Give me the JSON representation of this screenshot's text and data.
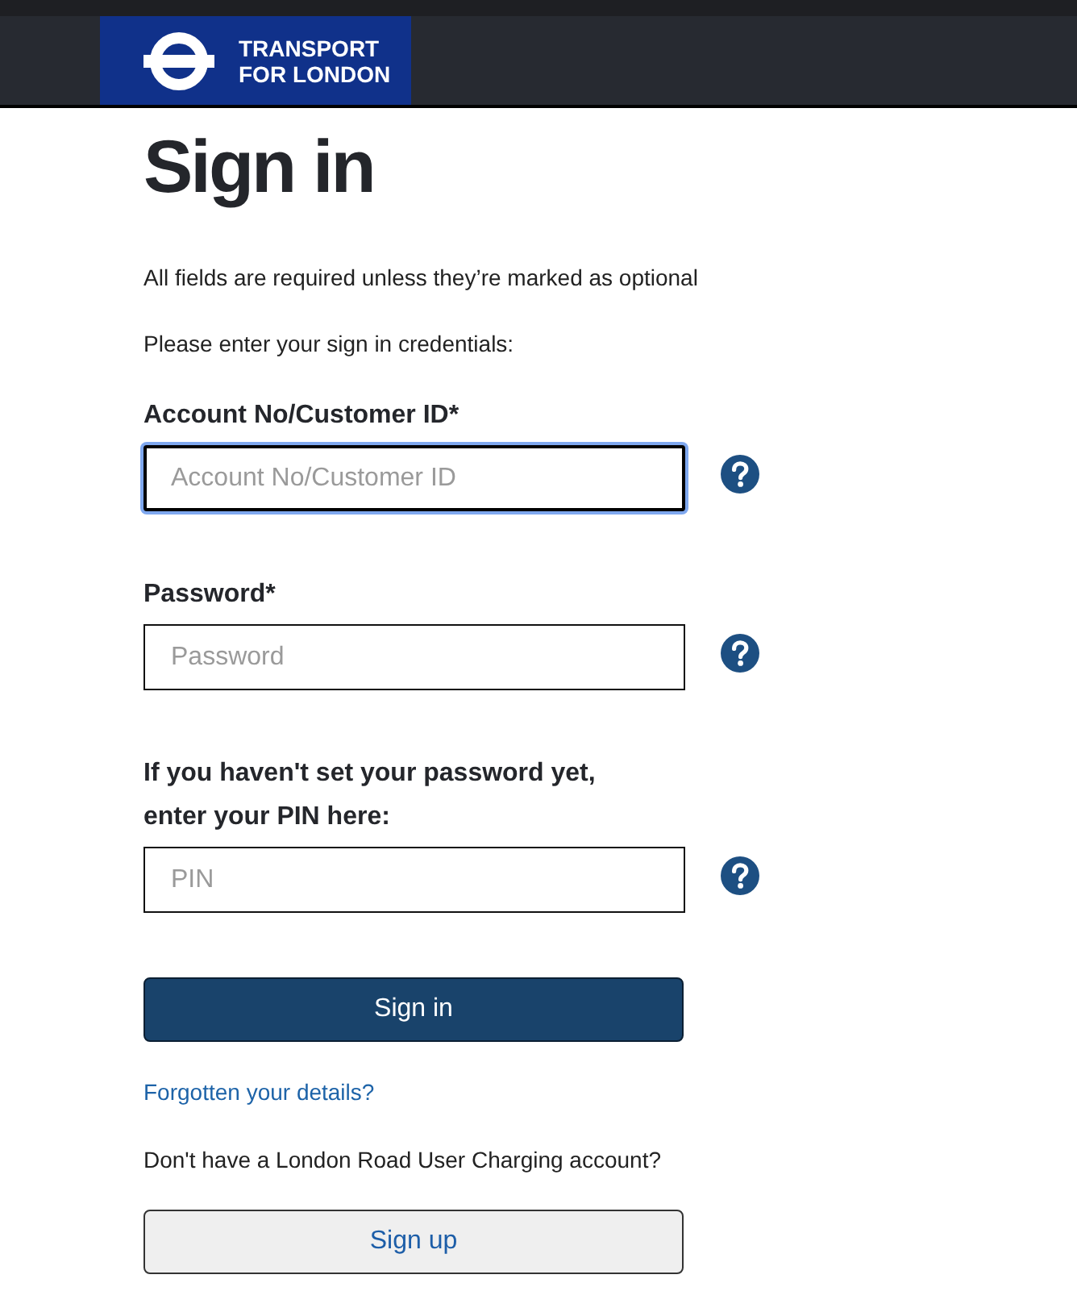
{
  "header": {
    "logo": {
      "lines": [
        "TRANSPORT",
        "FOR LONDON"
      ]
    }
  },
  "title": "Sign in",
  "intro": [
    "All fields are required unless they’re marked as optional",
    "Please enter your sign in credentials:"
  ],
  "fields": [
    {
      "label": "Account No/Customer ID*",
      "placeholder": "Account No/Customer ID",
      "focused": true
    },
    {
      "label": "Password*",
      "placeholder": "Password",
      "focused": false
    },
    {
      "label": "If you haven't set your password yet, enter your PIN here:",
      "placeholder": "PIN",
      "focused": false
    }
  ],
  "sign_in_button": "Sign in",
  "forgot_link": "Forgotten your details?",
  "signup_prompt": "Don't have a London Road User Charging account?",
  "sign_up_button": "Sign up"
}
